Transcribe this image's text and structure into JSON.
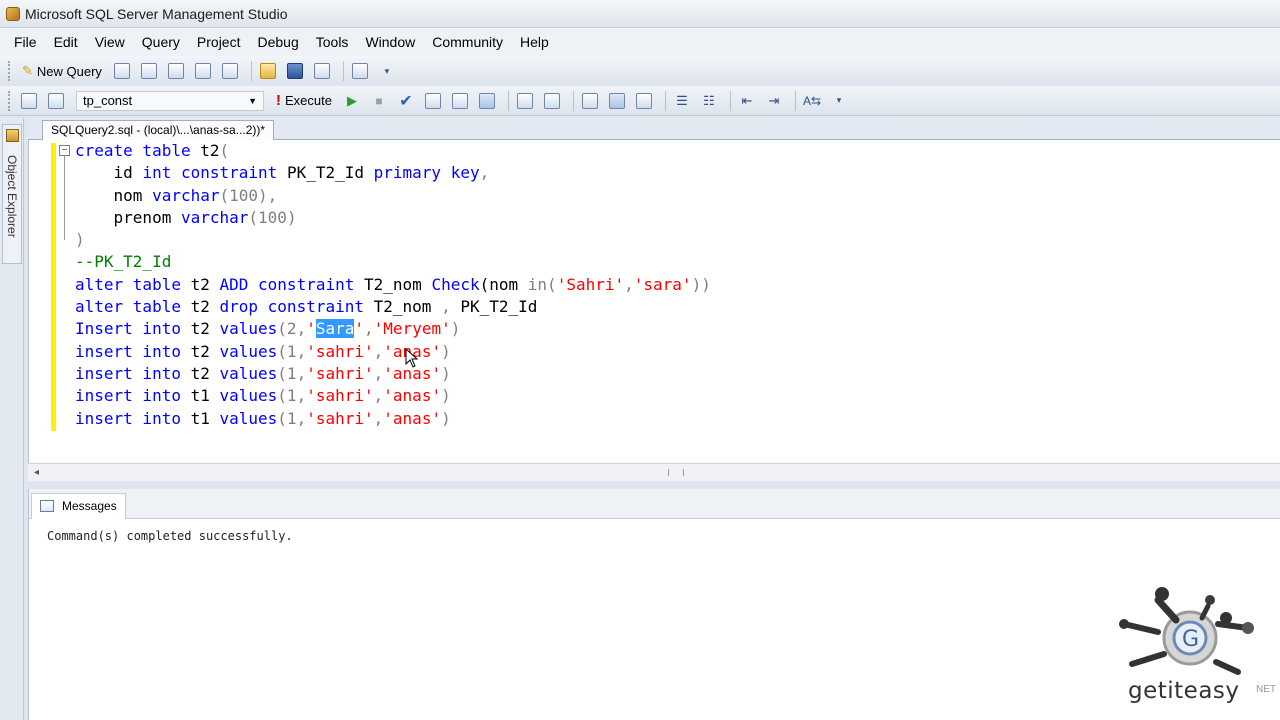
{
  "window": {
    "title": "Microsoft SQL Server Management Studio"
  },
  "menu": [
    "File",
    "Edit",
    "View",
    "Query",
    "Project",
    "Debug",
    "Tools",
    "Window",
    "Community",
    "Help"
  ],
  "toolbar": {
    "new_query_label": "New Query",
    "database_value": "tp_const",
    "execute_label": "Execute"
  },
  "side_panel": {
    "label": "Object Explorer"
  },
  "document_tab": {
    "label": "SQLQuery2.sql - (local)\\...\\anas-sa...2))*"
  },
  "code": {
    "l1a": "create table ",
    "l1b": "t2",
    "l1c": "(",
    "l2a": "    id ",
    "l2b": "int",
    "l2c": " constraint ",
    "l2d": "PK_T2_Id",
    "l2e": " primary key",
    "l2f": ",",
    "l3a": "    nom ",
    "l3b": "varchar",
    "l3c": "(100),",
    "l4a": "    prenom ",
    "l4b": "varchar",
    "l4c": "(100)",
    "l5": ")",
    "l6": "--PK_T2_Id",
    "l7a": "alter table ",
    "l7b": "t2 ",
    "l7c": "ADD constraint ",
    "l7d": "T2_nom ",
    "l7e": "Check",
    "l7f": "(nom ",
    "l7g": "in",
    "l7h": "(",
    "l7i": "'Sahri'",
    "l7j": ",",
    "l7k": "'sara'",
    "l7l": "))",
    "l8a": "alter table ",
    "l8b": "t2 ",
    "l8c": "drop constraint ",
    "l8d": "T2_nom ",
    "l8e": ", ",
    "l8f": "PK_T2_Id",
    "l9a": "Insert into ",
    "l9b": "t2 ",
    "l9c": "values",
    "l9d": "(2,",
    "l9e": "'",
    "l9f": "Sara",
    "l9g": "'",
    "l9h": ",",
    "l9i": "'Meryem'",
    "l9j": ")",
    "l10a": "insert into ",
    "l10b": "t2 ",
    "l10c": "values",
    "l10d": "(1,",
    "l10e": "'sahri'",
    "l10f": ",",
    "l10g": "'anas'",
    "l10h": ")",
    "l11a": "insert into ",
    "l11b": "t2 ",
    "l11c": "values",
    "l11d": "(1,",
    "l11e": "'sahri'",
    "l11f": ",",
    "l11g": "'anas'",
    "l11h": ")",
    "l12a": "insert into ",
    "l12b": "t1 ",
    "l12c": "values",
    "l12d": "(1,",
    "l12e": "'sahri'",
    "l12f": ",",
    "l12g": "'anas'",
    "l12h": ")",
    "l13a": "insert into ",
    "l13b": "t1 ",
    "l13c": "values",
    "l13d": "(1,",
    "l13e": "'sahri'",
    "l13f": ",",
    "l13g": "'anas'",
    "l13h": ")"
  },
  "results": {
    "tab_label": "Messages",
    "message": "Command(s) completed successfully."
  },
  "watermark": {
    "brand": "getiteasy",
    "suffix": "NET"
  },
  "colors": {
    "keyword": "#0000ff",
    "string": "#ff0000",
    "comment": "#008000",
    "function": "#ff00ff",
    "operator": "#808080",
    "selection": "#3399ff"
  }
}
